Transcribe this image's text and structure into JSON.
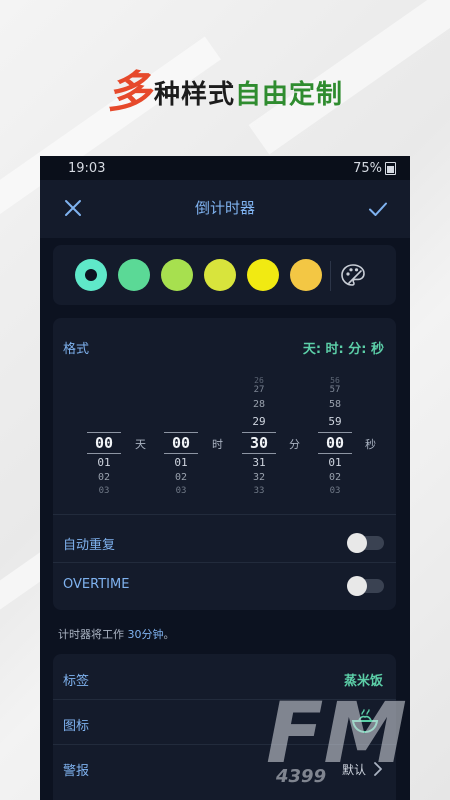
{
  "headline": {
    "big": "多",
    "mid": "种样式",
    "rest": "自由定制"
  },
  "status_bar": {
    "time": "19:03",
    "battery": "75%"
  },
  "app_bar": {
    "title": "倒计时器",
    "close_icon": "close-icon",
    "confirm_icon": "check-icon"
  },
  "colors": {
    "swatches": [
      "#5fe8c9",
      "#5bd996",
      "#a7e04f",
      "#d8e43c",
      "#f1ea12",
      "#f3c744"
    ],
    "selected_index": 0,
    "palette_icon": "palette-icon"
  },
  "format": {
    "label": "格式",
    "value": "天: 时: 分: 秒",
    "pickers": [
      {
        "unit": "天",
        "above": [],
        "selected": "00",
        "below": [
          "01",
          "02",
          "03"
        ]
      },
      {
        "unit": "时",
        "above": [],
        "selected": "00",
        "below": [
          "01",
          "02",
          "03"
        ]
      },
      {
        "unit": "分",
        "above": [
          "26",
          "27",
          "28",
          "29"
        ],
        "selected": "30",
        "below": [
          "31",
          "32",
          "33"
        ]
      },
      {
        "unit": "秒",
        "above": [
          "56",
          "57",
          "58",
          "59"
        ],
        "selected": "00",
        "below": [
          "01",
          "02",
          "03"
        ]
      }
    ],
    "auto_repeat": {
      "label": "自动重复",
      "on": false
    },
    "overtime": {
      "label": "OVERTIME",
      "on": false
    }
  },
  "note": {
    "prefix": "计时器将工作",
    "highlight": "30分钟",
    "suffix": "。"
  },
  "attributes": {
    "tag": {
      "label": "标签",
      "value": "蒸米饭"
    },
    "icon": {
      "label": "图标",
      "icon": "rice-bowl-icon"
    },
    "alert": {
      "label": "警报",
      "value": "默认"
    }
  },
  "watermark": {
    "text": "FM",
    "sub": "4399"
  },
  "accent_colors": {
    "title_blue": "#7fb2ef",
    "value_green": "#5ccfa8",
    "headline_red": "#e6492b",
    "headline_green": "#2f8c2f"
  }
}
